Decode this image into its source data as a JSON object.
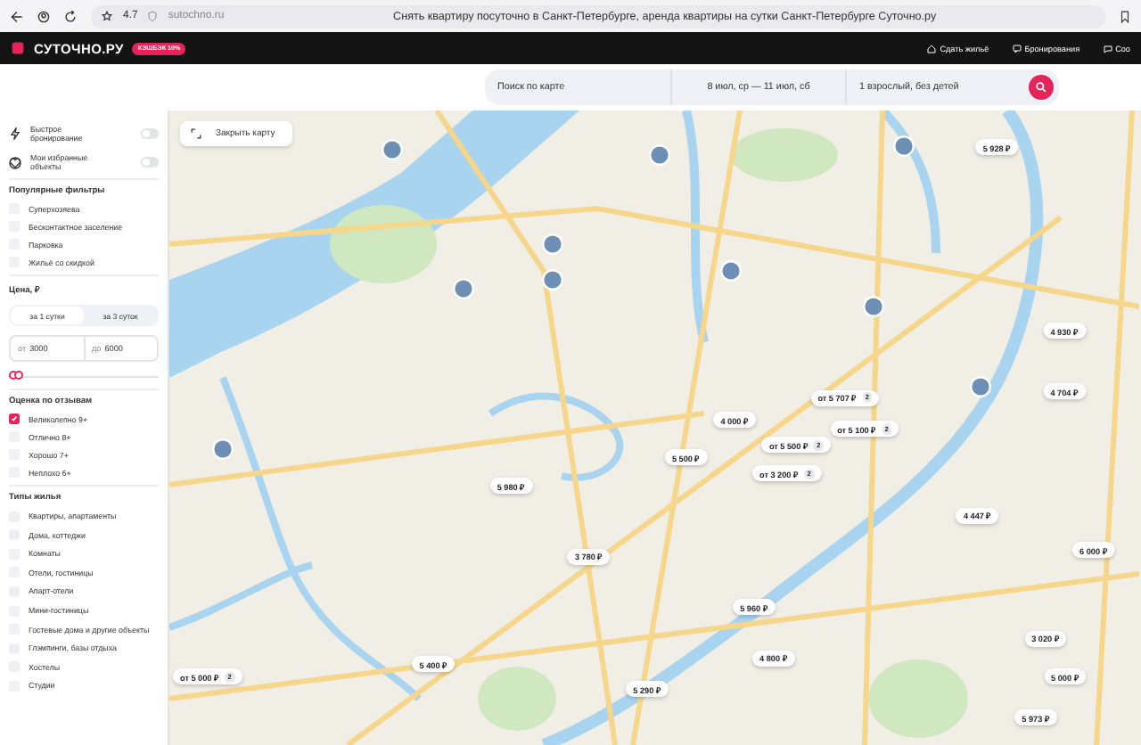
{
  "browser": {
    "rating": "4.7",
    "address": "sutochno.ru",
    "title": "Снять квартиру посуточно в Санкт-Петербурге, аренда квартиры на сутки Санкт-Петербурге Суточно.ру"
  },
  "header": {
    "logo": "СУТОЧНО.РУ",
    "badge": "КЭШБЭК 10%",
    "links": [
      {
        "label": "Сдать жильё",
        "kind": "house"
      },
      {
        "label": "Бронирования",
        "kind": "chat"
      },
      {
        "label": "Соо",
        "kind": "bubble"
      }
    ]
  },
  "search": {
    "place": "Поиск по карте",
    "dates": "8 июл, ср — 11 июл, сб",
    "guests": "1 взрослый, без детей"
  },
  "sidebar": {
    "toggles": [
      {
        "label": "Быстрое бронирование",
        "kind": "bolt",
        "on": false
      },
      {
        "label": "Мои избранные объекты",
        "kind": "heart",
        "on": false
      }
    ],
    "popular": {
      "title": "Популярные фильтры",
      "items": [
        {
          "label": "Суперхозяева",
          "checked": false
        },
        {
          "label": "Бесконтактное заселение",
          "checked": false
        },
        {
          "label": "Парковка",
          "checked": false
        },
        {
          "label": "Жильё со скидкой",
          "checked": false
        }
      ]
    },
    "price": {
      "title": "Цена, ₽",
      "periods": [
        {
          "label": "за 1 сутки",
          "selected": true
        },
        {
          "label": "за 3 суток",
          "selected": false
        }
      ],
      "from_label": "от",
      "from": "3000",
      "to_label": "до",
      "to": "6000",
      "thumbs": [
        {
          "level": 0
        },
        {
          "level": 0.04
        }
      ]
    },
    "rating": {
      "title": "Оценка по отзывам",
      "items": [
        {
          "label": "Великолепно 9+",
          "checked": true
        },
        {
          "label": "Отлично 8+",
          "checked": false
        },
        {
          "label": "Хорошо 7+",
          "checked": false
        },
        {
          "label": "Неплохо 6+",
          "checked": false
        }
      ]
    },
    "types": {
      "title": "Типы жилья",
      "items": [
        {
          "label": "Квартиры, апартаменты",
          "checked": false
        },
        {
          "label": "Дома, коттеджи",
          "checked": false
        },
        {
          "label": "Комнаты",
          "checked": false
        },
        {
          "label": "Отели, гостиницы",
          "checked": false
        },
        {
          "label": "Апарт-отели",
          "checked": false
        },
        {
          "label": "Мини-гостиницы",
          "checked": false
        },
        {
          "label": "Гостевые дома и другие объекты",
          "checked": false
        },
        {
          "label": "Глэмпинги, базы отдыха",
          "checked": false
        },
        {
          "label": "Хостелы",
          "checked": false
        },
        {
          "label": "Студии",
          "checked": false
        }
      ]
    }
  },
  "map": {
    "close_button": "Закрыть карту",
    "pins": [
      {
        "price": "5 928 ₽"
      },
      {
        "price": "4 930 ₽"
      },
      {
        "price": "4 704 ₽"
      },
      {
        "price": "от 5 707 ₽",
        "count": "2"
      },
      {
        "price": "4 000 ₽"
      },
      {
        "price": "от 5 100 ₽",
        "count": "2"
      },
      {
        "price": "от 5 500 ₽",
        "count": "2"
      },
      {
        "price": "5 500 ₽"
      },
      {
        "price": "от 3 200 ₽",
        "count": "2"
      },
      {
        "price": "5 980 ₽"
      },
      {
        "price": "4 447 ₽"
      },
      {
        "price": "6 000 ₽"
      },
      {
        "price": "3 780 ₽"
      },
      {
        "price": "5 960 ₽"
      },
      {
        "price": "3 020 ₽"
      },
      {
        "price": "4 800 ₽"
      },
      {
        "price": "5 400 ₽"
      },
      {
        "price": "от 5 000 ₽",
        "count": "2"
      },
      {
        "price": "5 000 ₽"
      },
      {
        "price": "5 290 ₽"
      },
      {
        "price": "5 973 ₽"
      }
    ]
  }
}
